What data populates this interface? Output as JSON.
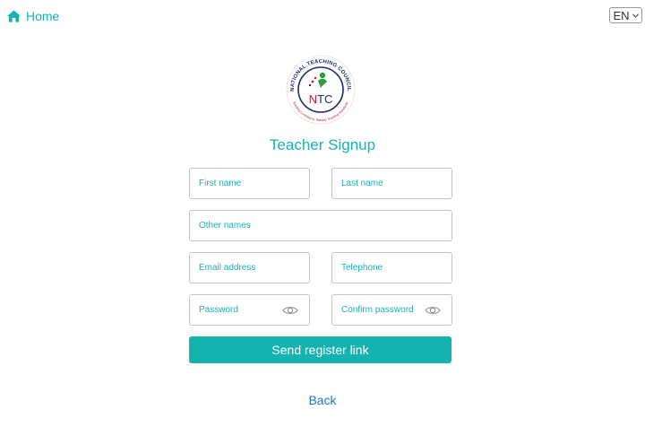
{
  "nav": {
    "home_label": "Home",
    "language": "EN"
  },
  "logo": {
    "ring_top_text": "NATIONAL TEACHING COUNCIL",
    "ring_bottom_text": "Building Confidence, Raising Teaching Standards",
    "acronym": "NTC"
  },
  "form": {
    "title": "Teacher Signup",
    "first_name_placeholder": "First name",
    "last_name_placeholder": "Last name",
    "other_names_placeholder": "Other names",
    "email_placeholder": "Email address",
    "telephone_placeholder": "Telephone",
    "password_placeholder": "Password",
    "confirm_password_placeholder": "Confirm password",
    "submit_label": "Send register link"
  },
  "footer": {
    "back_label": "Back"
  },
  "colors": {
    "accent": "#17b3b1",
    "button": "#15b3b0",
    "link": "#1976d2"
  }
}
